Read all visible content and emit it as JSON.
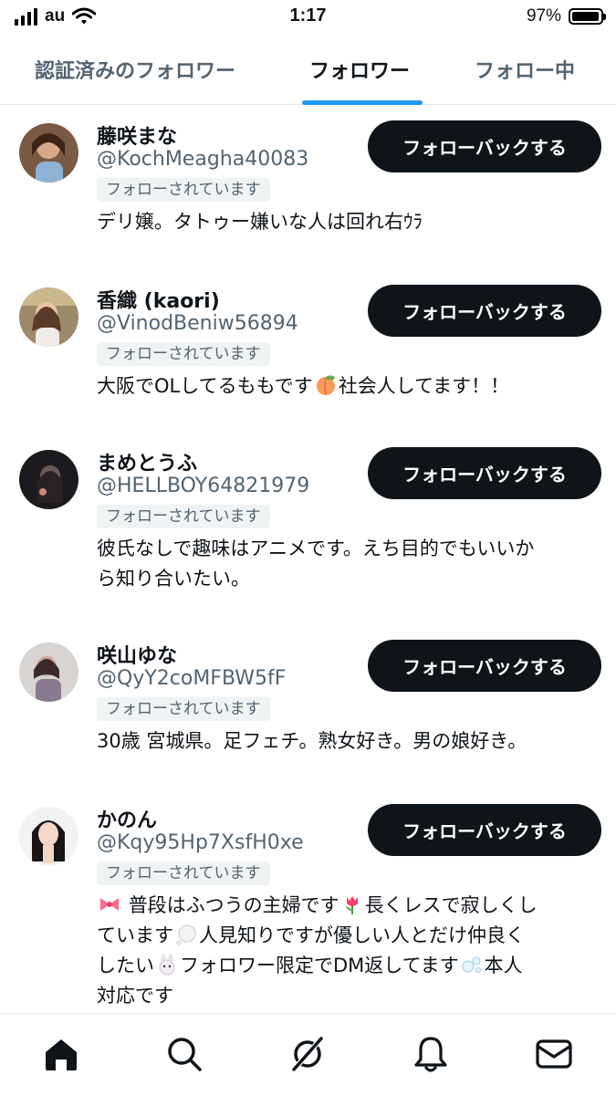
{
  "status_bar": {
    "carrier": "au",
    "time": "1:17",
    "battery": "97%",
    "battery_level": 0.97
  },
  "tabs": [
    {
      "label": "認証済みのフォロワー",
      "active": false
    },
    {
      "label": "フォロワー",
      "active": true
    },
    {
      "label": "フォロー中",
      "active": false
    }
  ],
  "users": [
    {
      "name": "藤咲まな",
      "handle": "@KochMeagha40083",
      "badge": "フォローされています",
      "button": "フォローバックする",
      "bio": [
        "デリ嬢。タトゥー嫌いな人は回れ右ｳﾗ"
      ]
    },
    {
      "name": "香織 (kaori)",
      "handle": "@VinodBeniw56894",
      "badge": "フォローされています",
      "button": "フォローバックする",
      "bio_parts": [
        "大阪でOLしてるももです",
        "社会人してます！！"
      ],
      "bio_emoji": "peach-emoji"
    },
    {
      "name": "まめとうふ",
      "handle": "@HELLBOY64821979",
      "badge": "フォローされています",
      "button": "フォローバックする",
      "bio": [
        "彼氏なしで趣味はアニメです。えち目的でもいいか",
        "ら知り合いたい。"
      ]
    },
    {
      "name": "咲山ゆな",
      "handle": "@QyY2coMFBW5fF",
      "badge": "フォローされています",
      "button": "フォローバックする",
      "bio": [
        "30歳 宮城県。足フェチ。熟女好き。男の娘好き。"
      ]
    },
    {
      "name": "かのん",
      "handle": "@Kqy95Hp7XsfH0xe",
      "badge": "フォローされています",
      "button": "フォローバックする",
      "bio_parts": [
        "普段はふつうの主婦です",
        "長くレスで寂しくし",
        "ています",
        "人見知りですが優しい人とだけ仲良く",
        "したい",
        "フォロワー限定でDM返してます",
        "本人",
        "対応です"
      ]
    }
  ],
  "nav": [
    "home-icon",
    "search-icon",
    "grok-icon",
    "bell-icon",
    "mail-icon"
  ]
}
